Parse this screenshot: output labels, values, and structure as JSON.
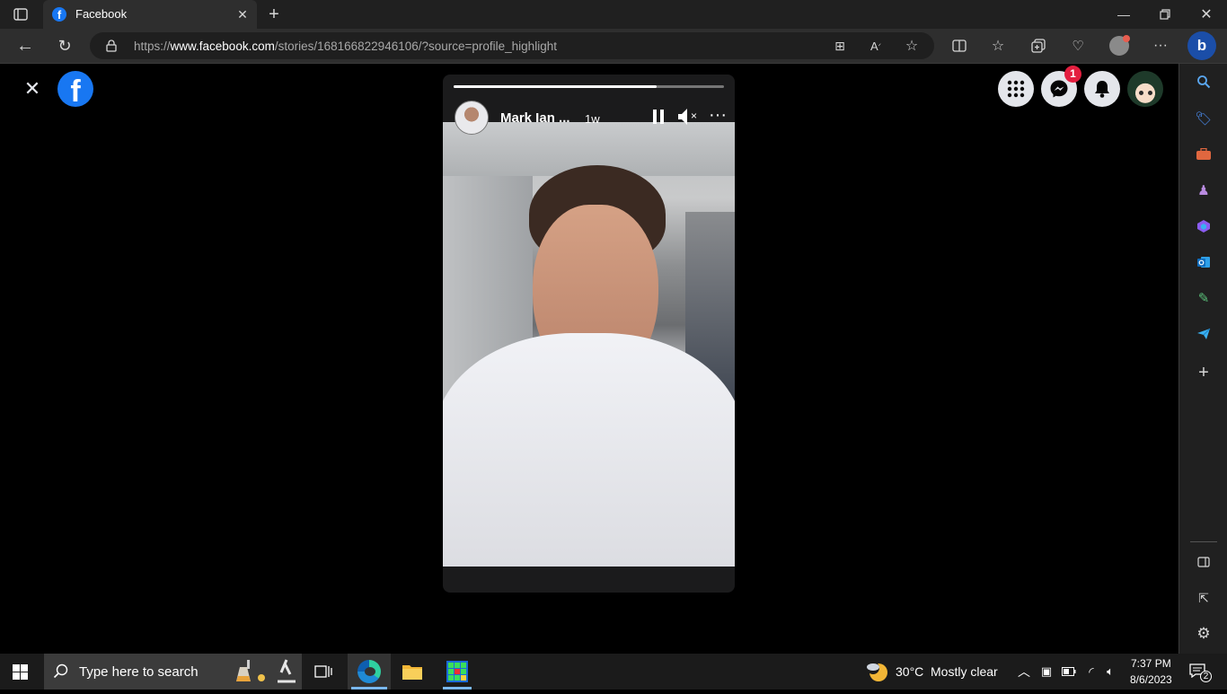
{
  "browser": {
    "tab_title": "Facebook",
    "url_prefix": "https://",
    "url_domain": "www.facebook.com",
    "url_path": "/stories/168166822946106/?source=profile_highlight"
  },
  "story": {
    "author": "Mark Ian ...",
    "time": "1w",
    "progress": 0.75,
    "mute_mark": "×"
  },
  "header": {
    "messenger_badge": "1"
  },
  "taskbar": {
    "search_placeholder": "Type here to search",
    "weather_temp": "30°C",
    "weather_text": "Mostly clear",
    "time": "7:37 PM",
    "date": "8/6/2023",
    "notification_count": "2"
  },
  "colors": {
    "facebook_blue": "#1877f2",
    "badge_red": "#e41e3f",
    "edge_blue": "#0078d4"
  }
}
